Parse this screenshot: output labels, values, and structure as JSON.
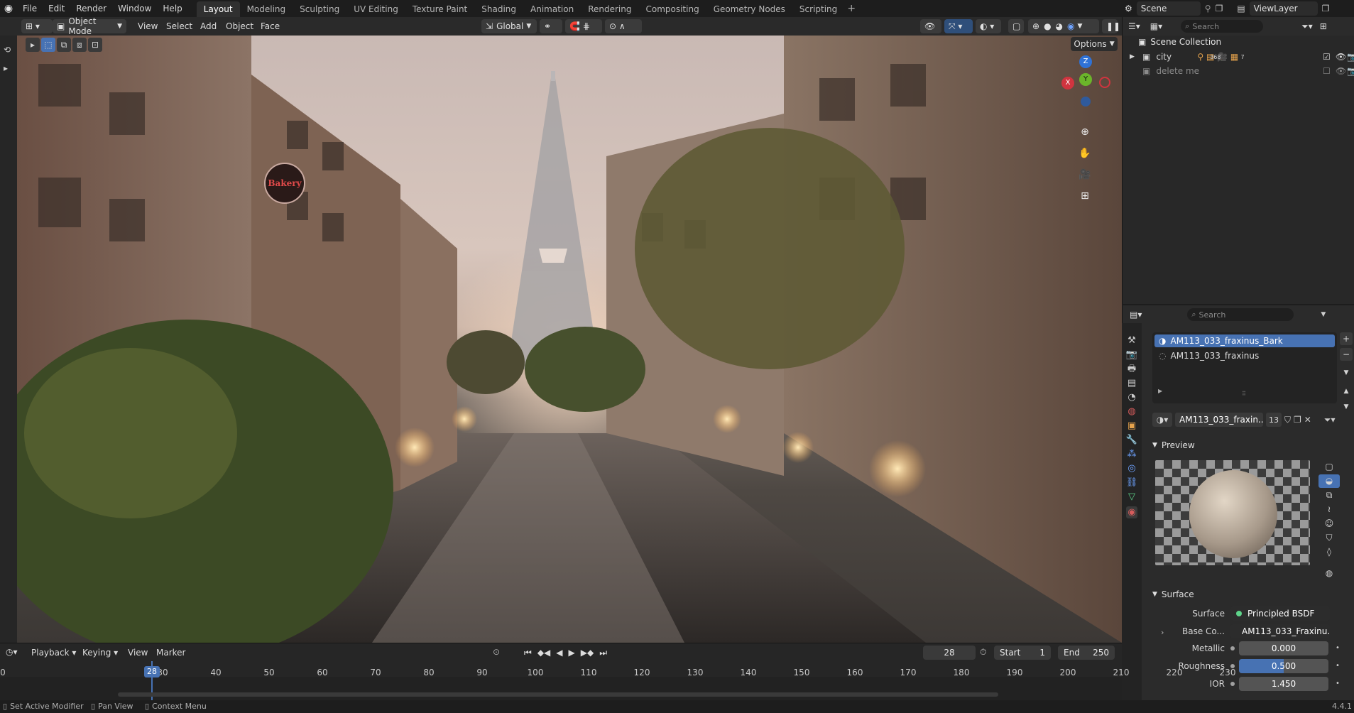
{
  "menu": [
    "File",
    "Edit",
    "Render",
    "Window",
    "Help"
  ],
  "workspaces": [
    "Layout",
    "Modeling",
    "Sculpting",
    "UV Editing",
    "Texture Paint",
    "Shading",
    "Animation",
    "Rendering",
    "Compositing",
    "Geometry Nodes",
    "Scripting"
  ],
  "active_workspace": "Layout",
  "scene_name": "Scene",
  "view_layer": "ViewLayer",
  "viewport": {
    "mode": "Object Mode",
    "menus": [
      "View",
      "Select",
      "Add",
      "Object",
      "Face"
    ],
    "transform_orientation": "Global",
    "options_label": "Options",
    "gizmo": {
      "x": "X",
      "y": "Y",
      "z": "Z"
    },
    "scene_text": {
      "sign": "Bakery"
    }
  },
  "outliner": {
    "search_placeholder": "Search",
    "root": "Scene Collection",
    "items": [
      {
        "name": "city",
        "badge": "368",
        "badge2": "7"
      },
      {
        "name": "delete me"
      }
    ]
  },
  "properties": {
    "search_placeholder": "Search",
    "material_slots": [
      "AM113_033_fraxinus_Bark",
      "AM113_033_fraxinus"
    ],
    "material_name": "AM113_033_fraxin...",
    "user_count": "13",
    "preview_label": "Preview",
    "surface_section": "Surface",
    "surface_label": "Surface",
    "surface_value": "Principled BSDF",
    "base_color_label": "Base Co...",
    "base_color_value": "AM113_033_Fraxinu...",
    "metallic_label": "Metallic",
    "metallic_value": "0.000",
    "roughness_label": "Roughness",
    "roughness_value": "0.500",
    "roughness_fraction": 0.5,
    "ior_label": "IOR",
    "ior_value": "1.450"
  },
  "timeline": {
    "menus": [
      "Playback",
      "Keying",
      "View",
      "Marker"
    ],
    "current_frame": "28",
    "start_label": "Start",
    "start_value": "1",
    "end_label": "End",
    "end_value": "250",
    "ticks": [
      "30",
      "40",
      "50",
      "60",
      "70",
      "80",
      "90",
      "100",
      "110",
      "120",
      "130",
      "140",
      "150",
      "160",
      "170",
      "180",
      "190",
      "200",
      "210",
      "220",
      "230"
    ],
    "first_tick": "0"
  },
  "statusbar": {
    "left": "Set Active Modifier",
    "middle": "Pan View",
    "right": "Context Menu",
    "version": "4.4.1"
  },
  "colors": {
    "accent": "#4772b3",
    "active_tab": "#303030",
    "bg": "#1d1d1d",
    "playhead": "#4772b3"
  }
}
